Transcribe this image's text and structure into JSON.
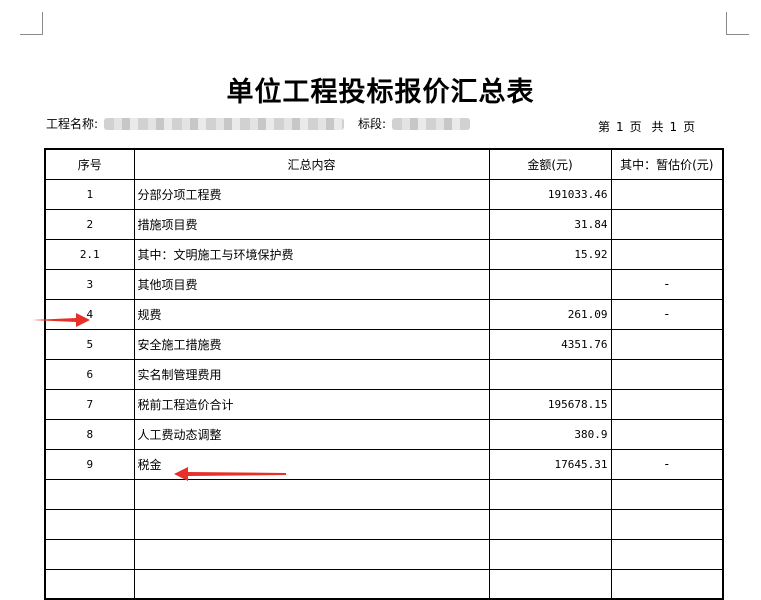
{
  "title": "单位工程投标报价汇总表",
  "meta": {
    "project_label": "工程名称:",
    "section_label": "标段:",
    "page_first": "第",
    "page_no": "1",
    "page_unit1": "页",
    "page_total_label": "共",
    "page_total": "1",
    "page_unit2": "页"
  },
  "table": {
    "headers": [
      "序号",
      "汇总内容",
      "金额(元)",
      "其中：暂估价(元)"
    ],
    "rows": [
      {
        "no": "1",
        "name": "分部分项工程费",
        "amount": "191033.46",
        "est": ""
      },
      {
        "no": "2",
        "name": "措施项目费",
        "amount": "31.84",
        "est": ""
      },
      {
        "no": "2.1",
        "name": "其中：文明施工与环境保护费",
        "amount": "15.92",
        "est": ""
      },
      {
        "no": "3",
        "name": "其他项目费",
        "amount": "",
        "est": "-"
      },
      {
        "no": "4",
        "name": "规费",
        "amount": "261.09",
        "est": "-"
      },
      {
        "no": "5",
        "name": "安全施工措施费",
        "amount": "4351.76",
        "est": ""
      },
      {
        "no": "6",
        "name": "实名制管理费用",
        "amount": "",
        "est": ""
      },
      {
        "no": "7",
        "name": "税前工程造价合计",
        "amount": "195678.15",
        "est": ""
      },
      {
        "no": "8",
        "name": "人工费动态调整",
        "amount": "380.9",
        "est": ""
      },
      {
        "no": "9",
        "name": "税金",
        "amount": "17645.31",
        "est": "-"
      },
      {
        "no": "",
        "name": "",
        "amount": "",
        "est": ""
      },
      {
        "no": "",
        "name": "",
        "amount": "",
        "est": ""
      },
      {
        "no": "",
        "name": "",
        "amount": "",
        "est": ""
      },
      {
        "no": "",
        "name": "",
        "amount": "",
        "est": ""
      }
    ]
  },
  "colors": {
    "annotation_arrow": "#e8302a"
  }
}
